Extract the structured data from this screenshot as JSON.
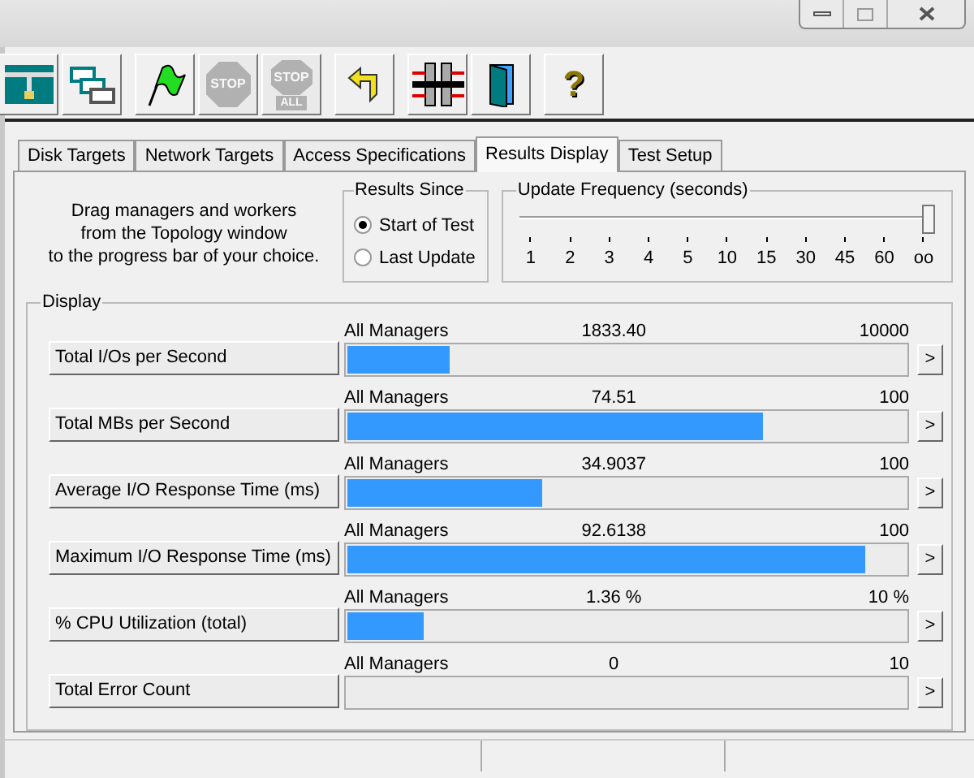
{
  "toolbar": {
    "groups": [
      [
        {
          "kind": "topology",
          "disabled": false
        },
        {
          "kind": "workers",
          "disabled": false
        }
      ],
      [
        {
          "kind": "start",
          "disabled": false
        },
        {
          "kind": "stop",
          "label": "STOP",
          "disabled": true
        },
        {
          "kind": "stop_all",
          "label": "STOP",
          "sublabel": "ALL",
          "disabled": true
        }
      ],
      [
        {
          "kind": "reset",
          "disabled": false
        }
      ],
      [
        {
          "kind": "split",
          "disabled": false
        },
        {
          "kind": "exit",
          "disabled": false
        }
      ],
      [
        {
          "kind": "help",
          "label": "?",
          "disabled": false
        }
      ]
    ]
  },
  "tabs": [
    {
      "label": "Disk Targets",
      "selected": false
    },
    {
      "label": "Network Targets",
      "selected": false
    },
    {
      "label": "Access Specifications",
      "selected": false
    },
    {
      "label": "Results Display",
      "selected": true
    },
    {
      "label": "Test Setup",
      "selected": false
    }
  ],
  "instructions": [
    "Drag managers and workers",
    "from the Topology window",
    "to the progress bar of your choice."
  ],
  "results_since": {
    "title": "Results Since",
    "options": [
      {
        "label": "Start of Test",
        "selected": true
      },
      {
        "label": "Last Update",
        "selected": false
      }
    ]
  },
  "update_frequency": {
    "title": "Update Frequency (seconds)",
    "level": 1,
    "ticks": [
      "1",
      "2",
      "3",
      "4",
      "5",
      "10",
      "15",
      "30",
      "45",
      "60",
      "oo"
    ]
  },
  "display": {
    "title": "Display",
    "rows": [
      {
        "name": "Total I/Os per Second",
        "source": "All Managers",
        "value": "1833.40",
        "max": "10000",
        "level": 0.183,
        "arrow": ">"
      },
      {
        "name": "Total MBs per Second",
        "source": "All Managers",
        "value": "74.51",
        "max": "100",
        "level": 0.745,
        "arrow": ">"
      },
      {
        "name": "Average I/O Response Time (ms)",
        "source": "All Managers",
        "value": "34.9037",
        "max": "100",
        "level": 0.349,
        "arrow": ">"
      },
      {
        "name": "Maximum I/O Response Time (ms)",
        "source": "All Managers",
        "value": "92.6138",
        "max": "100",
        "level": 0.926,
        "arrow": ">"
      },
      {
        "name": "% CPU Utilization (total)",
        "source": "All Managers",
        "value": "1.36 %",
        "max": "10 %",
        "level": 0.136,
        "arrow": ">"
      },
      {
        "name": "Total Error Count",
        "source": "All Managers",
        "value": "0",
        "max": "10",
        "level": 0,
        "arrow": ">"
      }
    ]
  }
}
